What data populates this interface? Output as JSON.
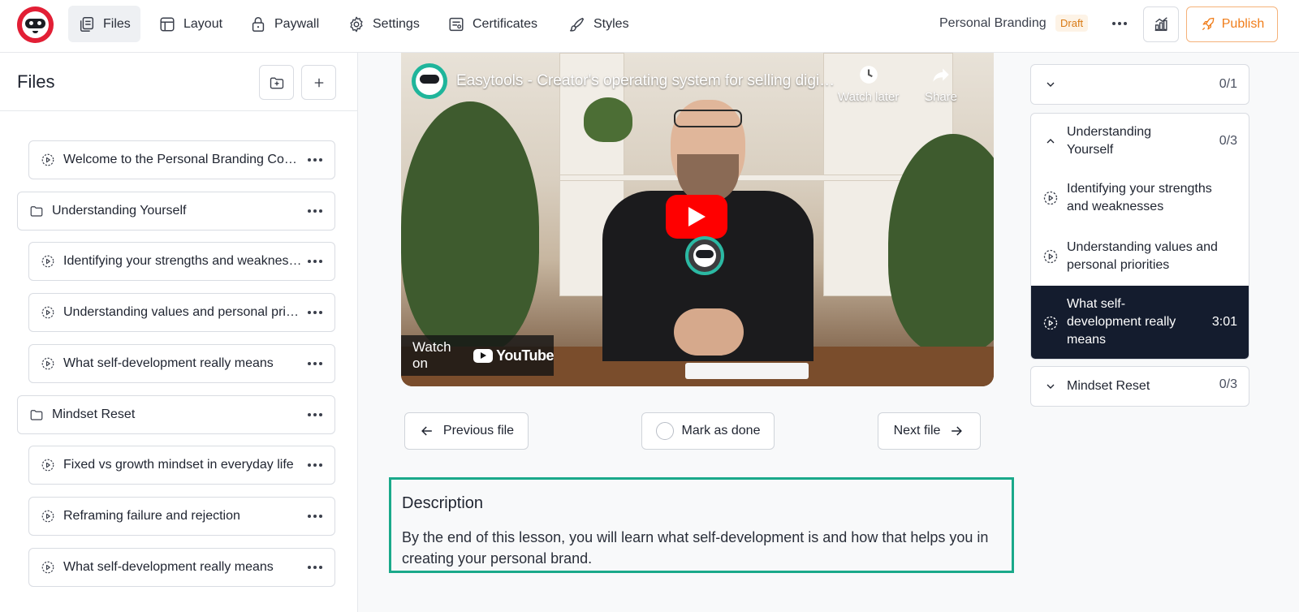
{
  "topbar": {
    "nav": [
      {
        "label": "Files",
        "active": true,
        "icon": "files-icon"
      },
      {
        "label": "Layout",
        "active": false,
        "icon": "layout-icon"
      },
      {
        "label": "Paywall",
        "active": false,
        "icon": "lock-icon"
      },
      {
        "label": "Settings",
        "active": false,
        "icon": "gear-icon"
      },
      {
        "label": "Certificates",
        "active": false,
        "icon": "certificate-icon"
      },
      {
        "label": "Styles",
        "active": false,
        "icon": "brush-icon"
      }
    ],
    "course_title": "Personal Branding",
    "status_badge": "Draft",
    "publish_label": "Publish"
  },
  "sidebar": {
    "title": "Files",
    "items": [
      {
        "type": "lesson",
        "label": "Welcome to the Personal Branding Course",
        "indent": true
      },
      {
        "type": "folder",
        "label": "Understanding Yourself",
        "indent": false
      },
      {
        "type": "lesson",
        "label": "Identifying your strengths and weaknesses",
        "indent": true
      },
      {
        "type": "lesson",
        "label": "Understanding values and personal priorities",
        "indent": true
      },
      {
        "type": "lesson",
        "label": "What self-development really means",
        "indent": true
      },
      {
        "type": "folder",
        "label": "Mindset Reset",
        "indent": false
      },
      {
        "type": "lesson",
        "label": "Fixed vs growth mindset in everyday life",
        "indent": true
      },
      {
        "type": "lesson",
        "label": "Reframing failure and rejection",
        "indent": true
      },
      {
        "type": "lesson",
        "label": "What self-development really means",
        "indent": true
      }
    ]
  },
  "video": {
    "title": "Easytools - Creator's operating system for selling digital products",
    "watch_later": "Watch later",
    "share": "Share",
    "watch_on": "Watch on",
    "youtube": "YouTube"
  },
  "controls": {
    "previous": "Previous file",
    "mark_done": "Mark as done",
    "next": "Next file"
  },
  "description": {
    "title": "Description",
    "text": "By the end of this lesson, you will learn what self-development is and how that helps you in creating your personal brand."
  },
  "outline": {
    "top_section": {
      "label": "",
      "count": "0/1",
      "expanded": false
    },
    "section_understanding": {
      "label": "Understanding Yourself",
      "count": "0/3",
      "expanded": true,
      "lessons": [
        {
          "label": "Identifying your strengths and weaknesses",
          "duration": "",
          "active": false
        },
        {
          "label": "Understanding values and personal priorities",
          "duration": "",
          "active": false
        },
        {
          "label": "What self-development really means",
          "duration": "3:01",
          "active": true
        }
      ]
    },
    "section_mindset": {
      "label": "Mindset Reset",
      "count": "0/3",
      "expanded": false
    }
  },
  "colors": {
    "accent_orange": "#f07d1a",
    "brand_red": "#e21f35",
    "active_dark": "#141c2e",
    "highlight_teal": "#1aa98a"
  }
}
